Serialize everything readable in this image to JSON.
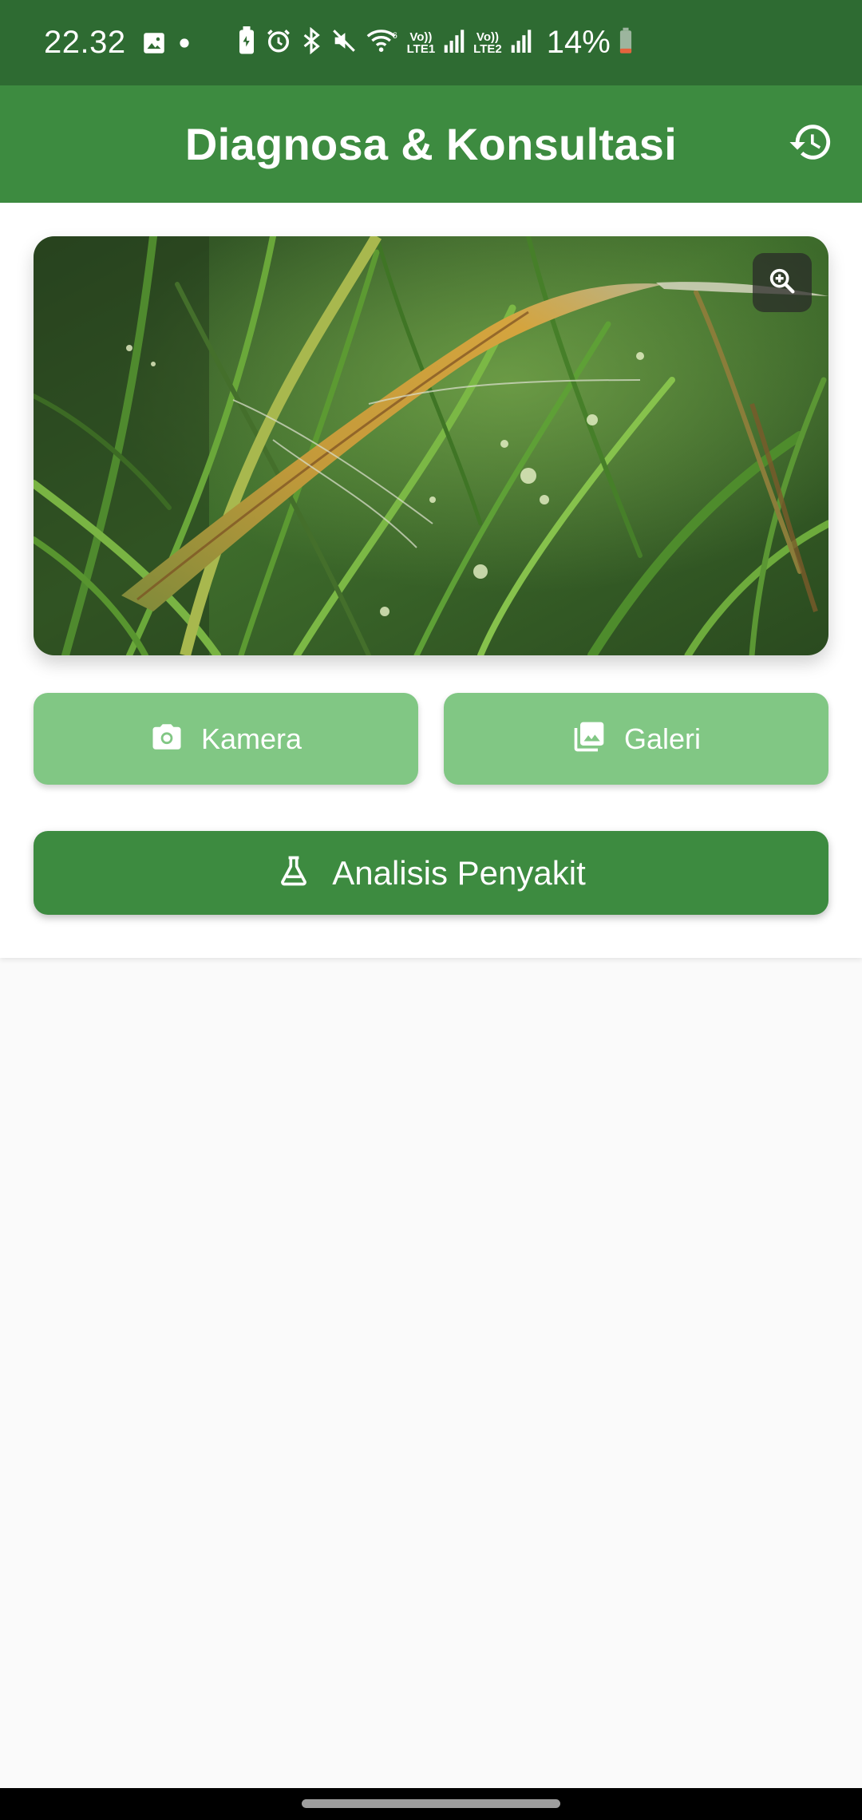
{
  "status_bar": {
    "time": "22.32",
    "sim1_label_top": "Vo))",
    "sim1_label_bottom": "LTE1",
    "sim2_label_top": "Vo))",
    "sim2_label_bottom": "LTE2",
    "battery": "14%",
    "icons": [
      "image-icon",
      "dot-icon",
      "battery-saver-icon",
      "alarm-icon",
      "bluetooth-icon",
      "mute-icon",
      "wifi-icon",
      "signal-icon",
      "battery-icon"
    ]
  },
  "app_bar": {
    "title": "Diagnosa & Konsultasi",
    "history_icon": "history-icon"
  },
  "image_preview": {
    "zoom_icon": "zoom-in-icon"
  },
  "actions": {
    "camera_label": "Kamera",
    "camera_icon": "camera-icon",
    "gallery_label": "Galeri",
    "gallery_icon": "photo-library-icon",
    "analyze_label": "Analisis Penyakit",
    "analyze_icon": "flask-icon"
  },
  "colors": {
    "status_bar": "#2e6b32",
    "primary": "#3d8b40",
    "primary_light": "#81c784",
    "background": "#fafafa"
  }
}
